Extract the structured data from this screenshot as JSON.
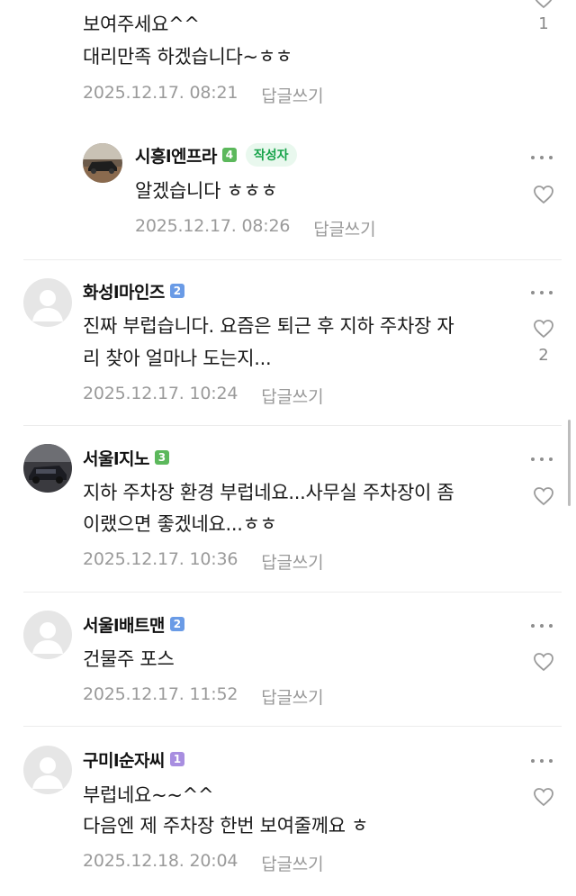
{
  "colors": {
    "level_green": "#5cb85c",
    "level_blue": "#6a9be6",
    "level_purple": "#a88ee0",
    "writer_badge_bg": "#e9f8ee",
    "writer_badge_text": "#17a34a",
    "meta_gray": "#9a9a9a"
  },
  "comments": [
    {
      "lines": [
        "보여주세요^^",
        "대리만족 하겠습니다~ㅎㅎ"
      ],
      "date": "2025.12.17. 08:21",
      "reply_label": "답글쓰기",
      "likes": "1"
    },
    {
      "author": "시흥l엔프라",
      "level": "4",
      "writer_badge": "작성자",
      "lines": [
        "알겠습니다 ㅎㅎㅎ"
      ],
      "date": "2025.12.17. 08:26",
      "reply_label": "답글쓰기"
    },
    {
      "author": "화성l마인즈",
      "level": "2",
      "lines": [
        "진짜 부럽습니다. 요즘은 퇴근 후 지하 주차장 자",
        "리 찾아 얼마나 도는지..."
      ],
      "date": "2025.12.17. 10:24",
      "reply_label": "답글쓰기",
      "likes": "2"
    },
    {
      "author": "서울l지노",
      "level": "3",
      "lines": [
        "지하 주차장 환경 부럽네요...사무실 주차장이 좀",
        "이랬으면 좋겠네요...ㅎㅎ"
      ],
      "date": "2025.12.17. 10:36",
      "reply_label": "답글쓰기"
    },
    {
      "author": "서울l배트맨",
      "level": "2",
      "lines": [
        "건물주 포스"
      ],
      "date": "2025.12.17. 11:52",
      "reply_label": "답글쓰기"
    },
    {
      "author": "구미l순자씨",
      "level": "1",
      "lines": [
        "부럽네요~~^^",
        "다음엔 제 주차장 한번 보여줄께요 ㅎ"
      ],
      "date": "2025.12.18. 20:04",
      "reply_label": "답글쓰기"
    }
  ]
}
